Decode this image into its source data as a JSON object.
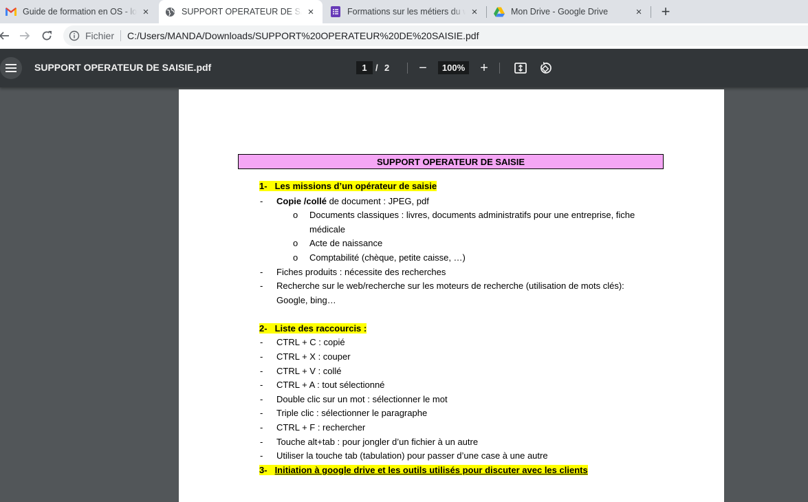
{
  "tabs": [
    {
      "title": "Guide de formation en OS - lova",
      "icon": "gmail-icon",
      "active": false
    },
    {
      "title": "SUPPORT OPERATEUR DE SAISIE",
      "icon": "globe-icon",
      "active": true
    },
    {
      "title": "Formations sur les métiers du web",
      "icon": "forms-icon",
      "active": false
    },
    {
      "title": "Mon Drive - Google Drive",
      "icon": "drive-icon",
      "active": false
    }
  ],
  "new_tab_label": "+",
  "close_label": "×",
  "address": {
    "scheme_label": "Fichier",
    "url": "C:/Users/MANDA/Downloads/SUPPORT%20OPERATEUR%20DE%20SAISIE.pdf"
  },
  "viewer": {
    "title": "SUPPORT OPERATEUR DE SAISIE.pdf",
    "current_page": "1",
    "page_sep": "/",
    "total_pages": "2",
    "zoom": "100%",
    "zoom_out_label": "−",
    "zoom_in_label": "+"
  },
  "document": {
    "title": "SUPPORT OPERATEUR DE SAISIE",
    "section1": {
      "number": "1-",
      "heading": "Les missions d’un opérateur de saisie",
      "item1_bold": "Copie /collé",
      "item1_rest": " de document : JPEG, pdf",
      "sub1_line1": "Documents classiques : livres, documents administratifs pour une entreprise, fiche",
      "sub1_line2": "médicale",
      "sub2": "Acte de naissance",
      "sub3": "Comptabilité (chèque, petite caisse, …)",
      "item2": "Fiches produits : nécessite des recherches",
      "item3_line1": "Recherche sur le web/recherche sur les moteurs de recherche (utilisation de mots clés):",
      "item3_line2": "Google, bing…"
    },
    "section2": {
      "number": "2-",
      "heading": "Liste des raccourcis :",
      "items": [
        "CTRL + C : copié",
        "CTRL + X : couper",
        "CTRL + V : collé",
        "CTRL + A : tout sélectionné",
        "Double clic sur un mot : sélectionner le mot",
        "Triple clic : sélectionner le paragraphe",
        "CTRL + F : rechercher",
        "Touche alt+tab : pour jongler d’un fichier à un autre",
        "Utiliser la touche tab (tabulation) pour passer d’une case à une autre"
      ]
    },
    "section3": {
      "number": "3-",
      "heading": "Initiation à google drive et les outils utilisés pour discuter avec les clients"
    },
    "dash": "-",
    "circle": "o"
  },
  "colors": {
    "title_box": "#f5a6f5",
    "highlight": "#ffff00",
    "viewer_bar": "#323639",
    "viewer_bg": "#525659"
  }
}
